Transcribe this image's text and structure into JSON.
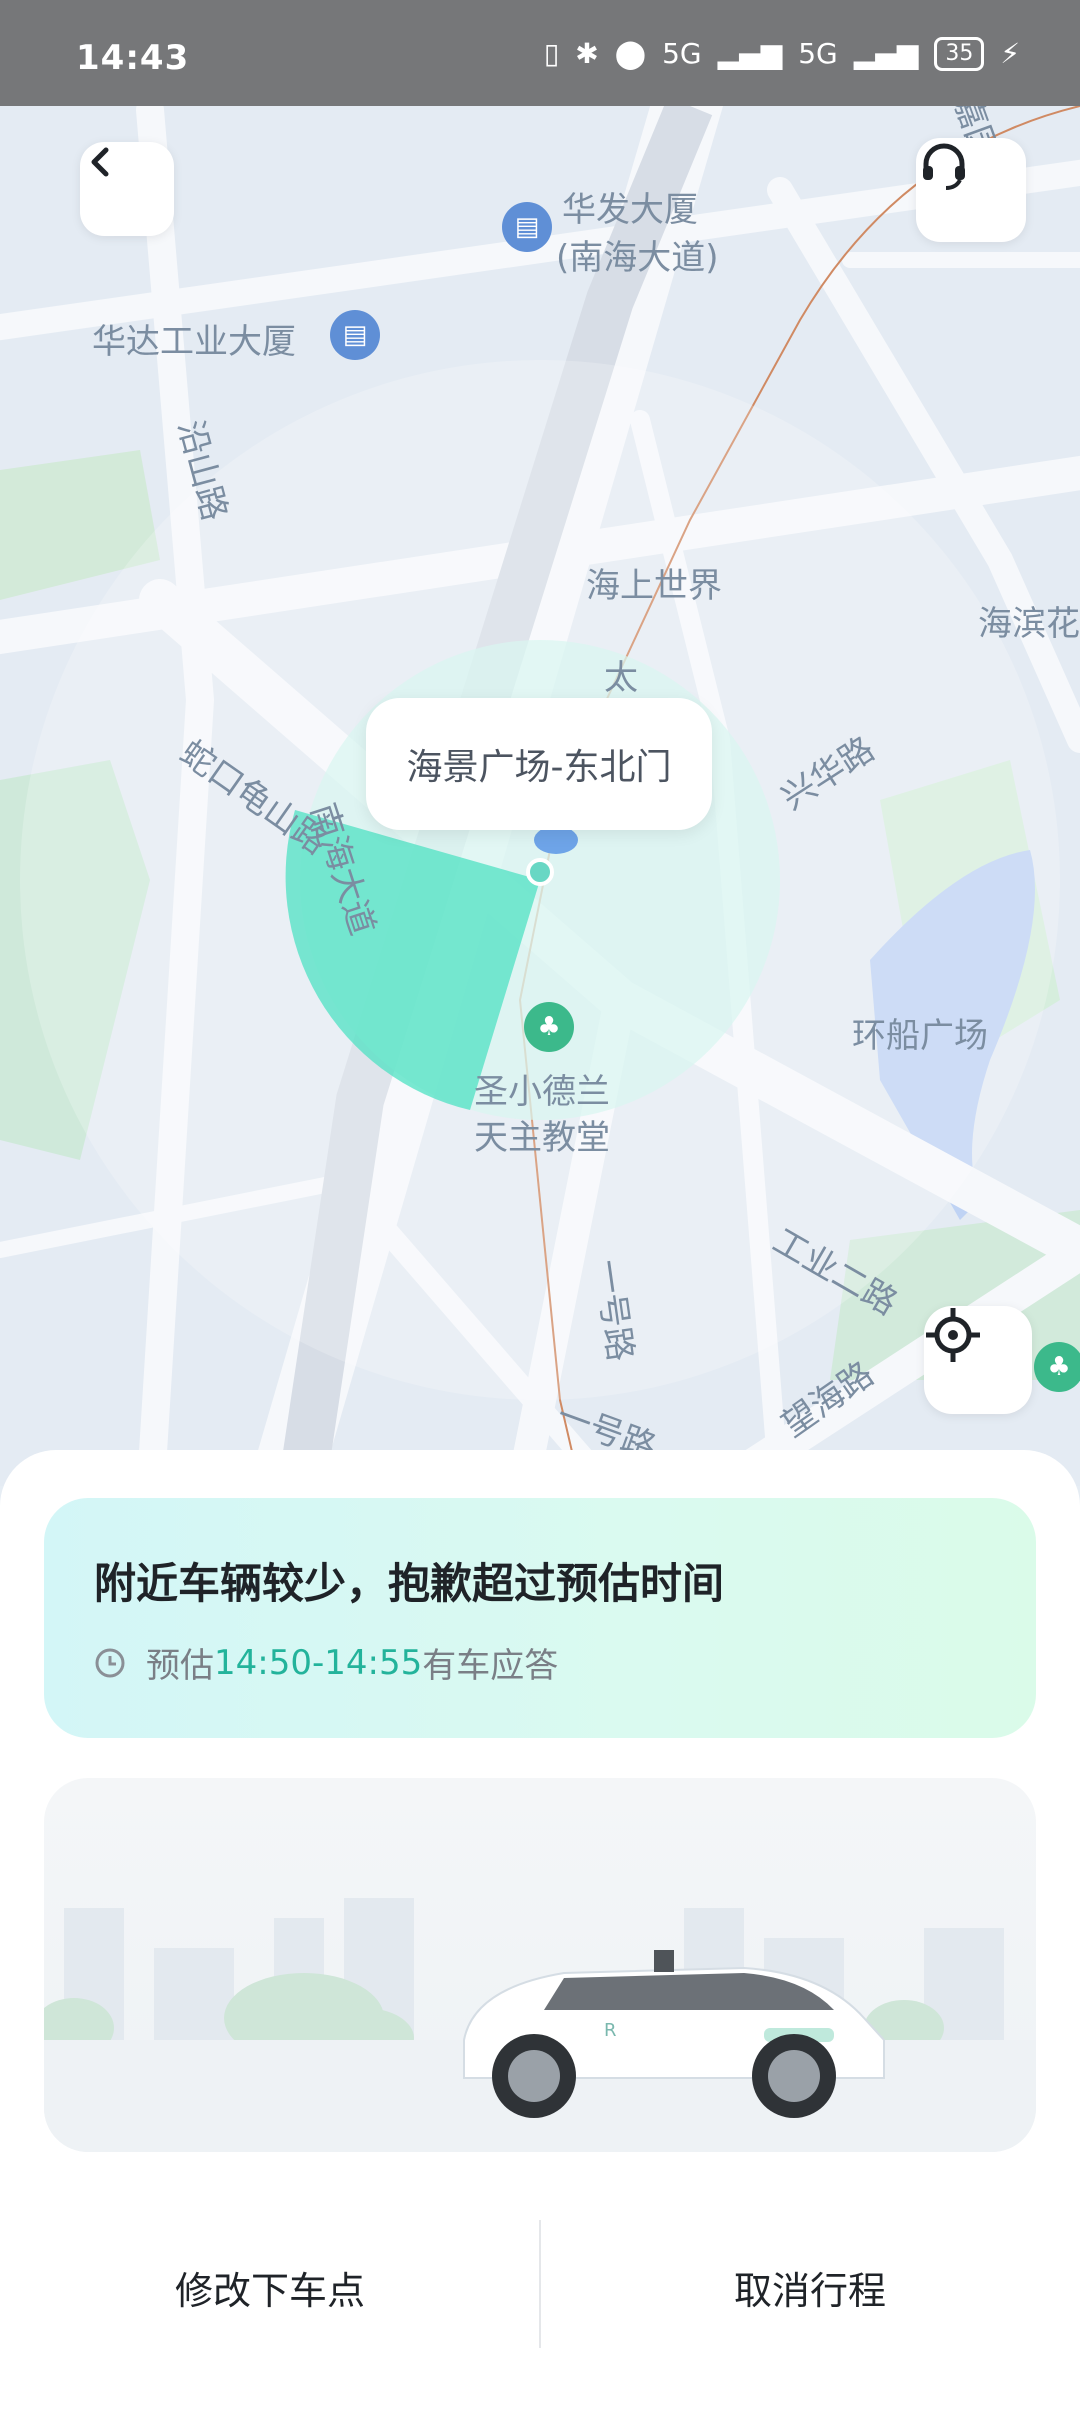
{
  "status_bar": {
    "time": "14:43",
    "signal1": "5G",
    "signal2": "5G",
    "battery": "35"
  },
  "map": {
    "labels": {
      "huafa": "华发大厦",
      "huafa_sub": "(南海大道)",
      "huada": "华达工业大厦",
      "yanshan": "沿山路",
      "haishang": "海上世界",
      "xinghua": "兴华路",
      "haibin": "海滨花",
      "shekou": "蛇口龟山路",
      "nanhai": "南海大道",
      "tai": "太",
      "shengxiao_line1": "圣小德兰",
      "shengxiao_line2": "天主教堂",
      "huanchuan": "环船广场",
      "gongye": "工业二路",
      "wanghai": "望海路",
      "yihao1": "一号路",
      "yihao2": "一号路",
      "jiayuan": "嘉园路"
    },
    "pickup_label": "海景广场-东北门"
  },
  "eta": {
    "title": "附近车辆较少，抱歉超过预估时间",
    "prefix": "预估",
    "time_range": "14:50-14:55",
    "suffix": "有车应答"
  },
  "actions": {
    "modify": "修改下车点",
    "cancel": "取消行程"
  }
}
